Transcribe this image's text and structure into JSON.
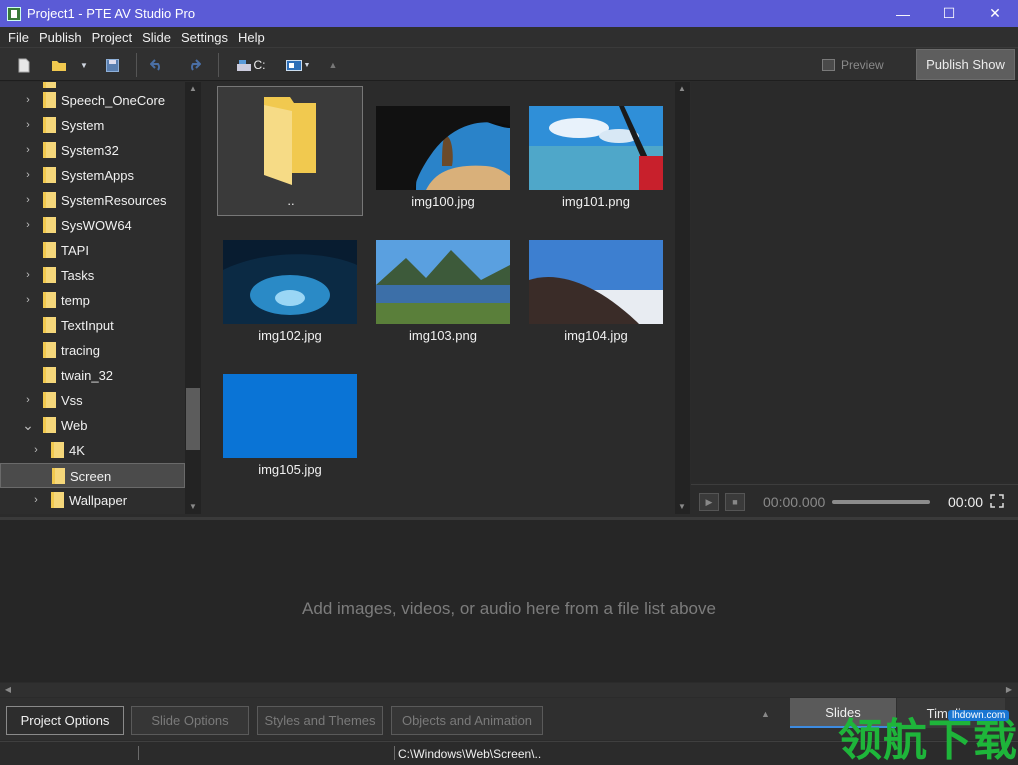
{
  "window": {
    "title": "Project1 - PTE AV Studio Pro",
    "minimize": "—",
    "maximize": "☐",
    "close": "✕"
  },
  "menu": [
    "File",
    "Publish",
    "Project",
    "Slide",
    "Settings",
    "Help"
  ],
  "toolbar": {
    "drive_label": "C:",
    "preview_label": "Preview",
    "publish_label": "Publish Show"
  },
  "tree": {
    "items": [
      {
        "label": "Speech_OneCore",
        "expandable": true,
        "indent": 0
      },
      {
        "label": "System",
        "expandable": true,
        "indent": 0
      },
      {
        "label": "System32",
        "expandable": true,
        "indent": 0
      },
      {
        "label": "SystemApps",
        "expandable": true,
        "indent": 0
      },
      {
        "label": "SystemResources",
        "expandable": true,
        "indent": 0
      },
      {
        "label": "SysWOW64",
        "expandable": true,
        "indent": 0
      },
      {
        "label": "TAPI",
        "expandable": false,
        "indent": 0
      },
      {
        "label": "Tasks",
        "expandable": true,
        "indent": 0
      },
      {
        "label": "temp",
        "expandable": true,
        "indent": 0
      },
      {
        "label": "TextInput",
        "expandable": false,
        "indent": 0
      },
      {
        "label": "tracing",
        "expandable": false,
        "indent": 0
      },
      {
        "label": "twain_32",
        "expandable": false,
        "indent": 0
      },
      {
        "label": "Vss",
        "expandable": true,
        "indent": 0
      },
      {
        "label": "Web",
        "expandable": true,
        "expanded": true,
        "indent": 0
      },
      {
        "label": "4K",
        "expandable": true,
        "indent": 1
      },
      {
        "label": "Screen",
        "expandable": false,
        "indent": 1,
        "selected": true
      },
      {
        "label": "Wallpaper",
        "expandable": true,
        "indent": 1
      }
    ]
  },
  "files": [
    {
      "name": "..",
      "kind": "parent-folder",
      "selected": true
    },
    {
      "name": "img100.jpg",
      "kind": "cave-beach"
    },
    {
      "name": "img101.png",
      "kind": "sky-window"
    },
    {
      "name": "img102.jpg",
      "kind": "ice-cave"
    },
    {
      "name": "img103.png",
      "kind": "mountain-lake"
    },
    {
      "name": "img104.jpg",
      "kind": "hill-sky"
    },
    {
      "name": "img105.jpg",
      "kind": "solid-blue"
    }
  ],
  "playback": {
    "current_time": "00:00.000",
    "total_time": "00:00"
  },
  "slide_area": {
    "hint": "Add images, videos, or audio here from a file list above"
  },
  "bottom": {
    "buttons": [
      "Project Options",
      "Slide Options",
      "Styles and Themes",
      "Objects and Animation"
    ],
    "tabs": [
      "Slides",
      "Timeline"
    ]
  },
  "status": {
    "path": "C:\\Windows\\Web\\Screen\\.."
  },
  "watermark": {
    "text": "领航下载",
    "small": "lhdown.com"
  },
  "colors": {
    "titlebar": "#5b5bd6",
    "folder": "#f5d77a",
    "accent_blue": "#0a74d6"
  }
}
